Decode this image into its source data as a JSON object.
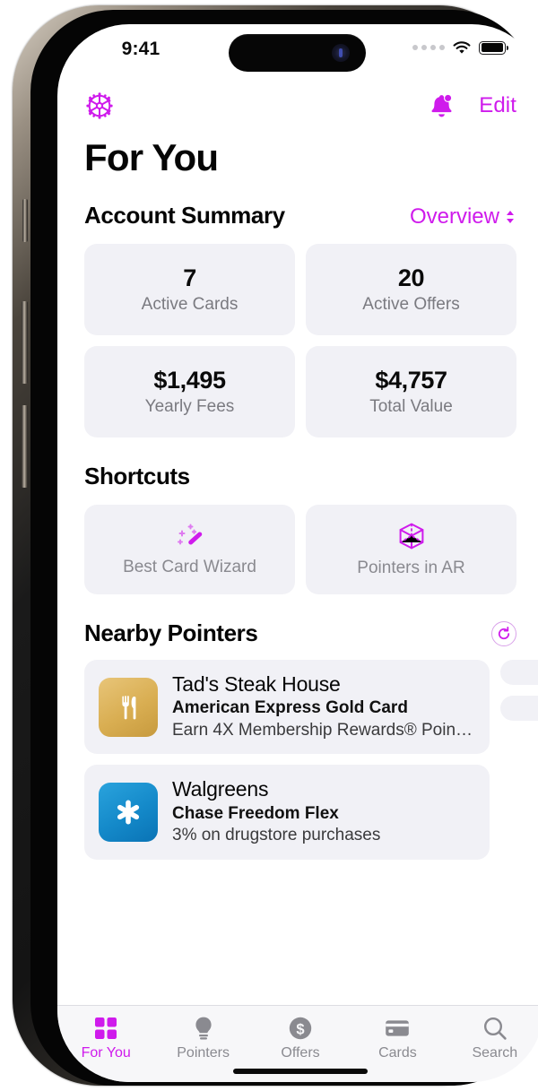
{
  "theme": {
    "accent": "#cf1bec",
    "card_bg": "#f1f1f6",
    "muted_text": "#8a8a90"
  },
  "status_bar": {
    "time": "9:41",
    "cellular_icon": "cellular-dots-icon",
    "wifi_icon": "wifi-icon",
    "battery_icon": "battery-icon"
  },
  "navbar": {
    "settings_icon": "gear-icon",
    "notifications_icon": "bell-icon",
    "edit_label": "Edit"
  },
  "page": {
    "title": "For You"
  },
  "account_summary": {
    "title": "Account Summary",
    "action_label": "Overview",
    "action_icon": "chevron-up-down-icon",
    "stats": [
      {
        "value": "7",
        "label": "Active Cards"
      },
      {
        "value": "20",
        "label": "Active Offers"
      },
      {
        "value": "$1,495",
        "label": "Yearly Fees"
      },
      {
        "value": "$4,757",
        "label": "Total Value"
      }
    ]
  },
  "shortcuts": {
    "title": "Shortcuts",
    "items": [
      {
        "label": "Best Card Wizard",
        "icon": "magic-wand-icon"
      },
      {
        "label": "Pointers in AR",
        "icon": "ar-cube-icon"
      }
    ]
  },
  "nearby_pointers": {
    "title": "Nearby Pointers",
    "refresh_icon": "refresh-icon",
    "cards": [
      {
        "name": "Tad's Steak House",
        "card": "American Express Gold Card",
        "description": "Earn 4X Membership Rewards® Points at...",
        "logo_icon": "fork-knife-icon"
      },
      {
        "name": "Walgreens",
        "card": "Chase Freedom Flex",
        "description": "3% on drugstore purchases",
        "logo_icon": "asterisk-icon"
      }
    ]
  },
  "tabbar": {
    "tabs": [
      {
        "label": "For You",
        "icon": "grid-squares-icon",
        "active": true
      },
      {
        "label": "Pointers",
        "icon": "lightbulb-icon",
        "active": false
      },
      {
        "label": "Offers",
        "icon": "dollar-circle-icon",
        "active": false
      },
      {
        "label": "Cards",
        "icon": "credit-card-icon",
        "active": false
      },
      {
        "label": "Search",
        "icon": "magnifier-icon",
        "active": false
      }
    ]
  }
}
